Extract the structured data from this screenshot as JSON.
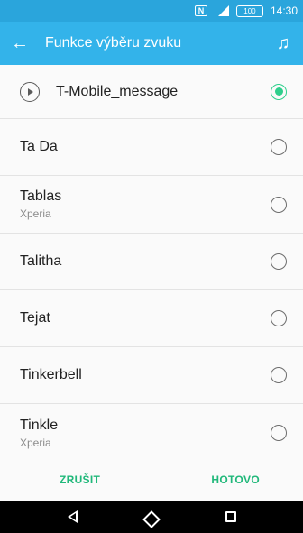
{
  "status_bar": {
    "nfc_label": "N",
    "battery": "100",
    "time": "14:30"
  },
  "app_bar": {
    "title": "Funkce výběru zvuku",
    "back_icon": "arrow-left-icon",
    "right_icon": "music-note-icon"
  },
  "items": [
    {
      "label": "T-Mobile_message",
      "sub": "",
      "selected": true
    },
    {
      "label": "Ta Da",
      "sub": "",
      "selected": false
    },
    {
      "label": "Tablas",
      "sub": "Xperia",
      "selected": false
    },
    {
      "label": "Talitha",
      "sub": "",
      "selected": false
    },
    {
      "label": "Tejat",
      "sub": "",
      "selected": false
    },
    {
      "label": "Tinkerbell",
      "sub": "",
      "selected": false
    },
    {
      "label": "Tinkle",
      "sub": "Xperia",
      "selected": false
    }
  ],
  "actions": {
    "cancel_label": "ZRUŠIT",
    "done_label": "HOTOVO"
  },
  "colors": {
    "status_bar": "#2aa5dc",
    "app_bar": "#33b3ea",
    "accent": "#20b87a"
  }
}
